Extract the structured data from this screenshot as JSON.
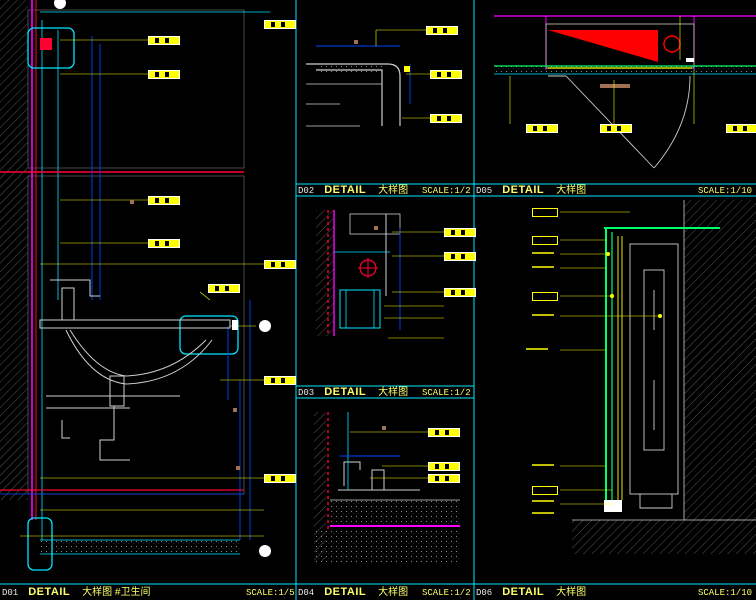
{
  "panels": [
    {
      "num": "D01",
      "keyword": "DETAIL",
      "title": "大样图 #卫生间",
      "scale": "SCALE:1/5"
    },
    {
      "num": "D02",
      "keyword": "DETAIL",
      "title": "大样图",
      "scale": "SCALE:1/2"
    },
    {
      "num": "D03",
      "keyword": "DETAIL",
      "title": "大样图",
      "scale": "SCALE:1/2"
    },
    {
      "num": "D04",
      "keyword": "DETAIL",
      "title": "大样图",
      "scale": "SCALE:1/2"
    },
    {
      "num": "D05",
      "keyword": "DETAIL",
      "title": "大样图",
      "scale": "SCALE:1/10"
    },
    {
      "num": "D06",
      "keyword": "DETAIL",
      "title": "大样图",
      "scale": "SCALE:1/10"
    }
  ],
  "colors": {
    "background": "#000000",
    "frame": "#00e5ff",
    "leader": "#ffff00",
    "wall": "#ff0033",
    "dimension": "#0044ff",
    "fixture": "#cfcfcf",
    "highlight": "#ff00ff",
    "insulation": "#00ff66"
  }
}
